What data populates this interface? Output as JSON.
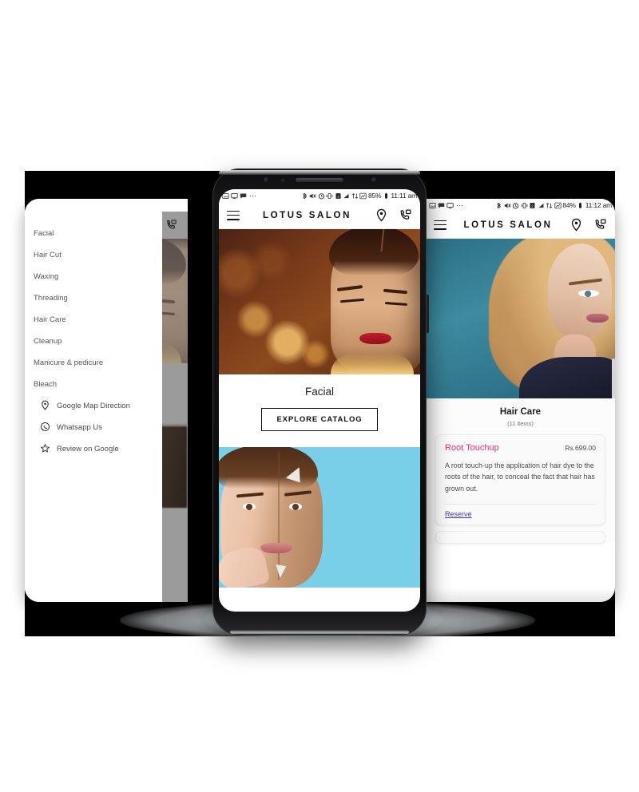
{
  "scene": {
    "title": "Lotus Salon mobile app showcase",
    "background_color": "#ffffff",
    "band_color": "#000000"
  },
  "brand": {
    "name": "LOTUS SALON",
    "accent_color": "#ec2c6e",
    "link_color": "#3a3ad0"
  },
  "status_bar_left": {
    "battery": "85%",
    "time": "11:11 am",
    "overflow": "⋯",
    "icons": [
      "photo-icon",
      "monitor-icon",
      "chat-icon",
      "bluetooth-icon",
      "mute-icon",
      "alarm-icon",
      "vibrate-icon",
      "sim-icon",
      "signal-icon",
      "data-sync-icon",
      "wifi-icon",
      "battery-icon"
    ]
  },
  "status_bar_center": {
    "battery": "85%",
    "time": "11:11 am",
    "overflow": "⋯"
  },
  "status_bar_right": {
    "battery": "84%",
    "time": "11:12 am",
    "overflow": "⋯"
  },
  "left_phone": {
    "drawer": {
      "items": [
        {
          "label": "Facial"
        },
        {
          "label": "Hair Cut"
        },
        {
          "label": "Waxing"
        },
        {
          "label": "Threading"
        },
        {
          "label": "Hair Care"
        },
        {
          "label": "Cleanup"
        },
        {
          "label": "Manicure & pedicure"
        },
        {
          "label": "Bleach"
        }
      ],
      "links": [
        {
          "label": "Google Map Direction",
          "icon": "map-pin-icon"
        },
        {
          "label": "Whatsapp Us",
          "icon": "whatsapp-icon"
        },
        {
          "label": "Review on Google",
          "icon": "star-icon"
        }
      ]
    }
  },
  "center_phone": {
    "appbar": {
      "menu_icon": "hamburger-icon",
      "title": "LOTUS SALON",
      "location_icon": "map-pin-icon",
      "call_icon": "phone-in-talk-icon"
    },
    "card": {
      "title": "Facial",
      "button": "EXPLORE CATALOG"
    }
  },
  "right_phone": {
    "appbar": {
      "menu_icon": "hamburger-icon",
      "title": "LOTUS SALON",
      "location_icon": "map-pin-icon",
      "call_icon": "phone-in-talk-icon"
    },
    "section": {
      "title": "Hair Care",
      "count": "(11 items)"
    },
    "service": {
      "name": "Root Touchup",
      "price": "Rs.699.00",
      "description": "A root touch-up the application of hair dye to the roots of the hair, to conceal the fact that hair has grown out.",
      "action": "Reserve"
    }
  }
}
